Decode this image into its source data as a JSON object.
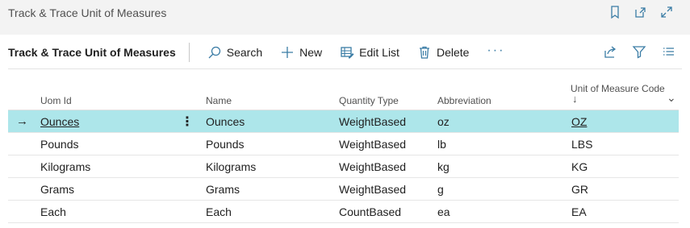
{
  "page": {
    "title": "Track & Trace Unit of Measures"
  },
  "top_icons": [
    "bookmark-icon",
    "open-new-window-icon",
    "expand-icon"
  ],
  "actionbar": {
    "title": "Track & Trace Unit of Measures",
    "search_label": "Search",
    "new_label": "New",
    "edit_list_label": "Edit List",
    "delete_label": "Delete",
    "more_label": "···",
    "right_icons": [
      "share-icon",
      "filter-icon",
      "list-view-icon"
    ]
  },
  "table": {
    "columns": {
      "uom_id": "Uom Id",
      "name": "Name",
      "quantity_type": "Quantity Type",
      "abbreviation": "Abbreviation",
      "unit_code": "Unit of Measure Code",
      "sort_indicator": "↓",
      "dropdown_indicator": "⌄"
    },
    "row_arrow": "→",
    "row_menu": "⋮",
    "rows": [
      {
        "uom_id": "Ounces",
        "name": "Ounces",
        "quantity_type": "WeightBased",
        "abbreviation": "oz",
        "unit_code": "OZ"
      },
      {
        "uom_id": "Pounds",
        "name": "Pounds",
        "quantity_type": "WeightBased",
        "abbreviation": "lb",
        "unit_code": "LBS"
      },
      {
        "uom_id": "Kilograms",
        "name": "Kilograms",
        "quantity_type": "WeightBased",
        "abbreviation": "kg",
        "unit_code": "KG"
      },
      {
        "uom_id": "Grams",
        "name": "Grams",
        "quantity_type": "WeightBased",
        "abbreviation": "g",
        "unit_code": "GR"
      },
      {
        "uom_id": "Each",
        "name": "Each",
        "quantity_type": "CountBased",
        "abbreviation": "ea",
        "unit_code": "EA"
      }
    ]
  },
  "colors": {
    "accent": "#3a7ca5",
    "selected_row": "#ade6ea",
    "background": "#f3f3f3"
  }
}
